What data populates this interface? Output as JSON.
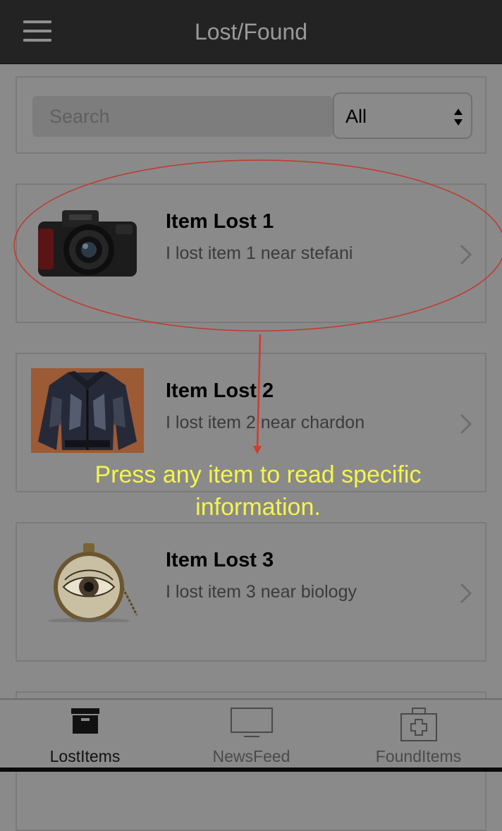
{
  "header": {
    "title": "Lost/Found",
    "menu_icon": "hamburger-icon"
  },
  "search": {
    "placeholder": "Search",
    "filter_value": "All"
  },
  "items": [
    {
      "title": "Item Lost 1",
      "description": "I lost item 1 near stefani",
      "image": "camera"
    },
    {
      "title": "Item Lost 2",
      "description": "I lost item 2 near chardon",
      "image": "jacket"
    },
    {
      "title": "Item Lost 3",
      "description": "I lost item 3 near biology",
      "image": "eye-pendant-necklace"
    }
  ],
  "tabs": [
    {
      "label": "LostItems",
      "icon": "archive-box-icon",
      "active": true
    },
    {
      "label": "NewsFeed",
      "icon": "monitor-icon",
      "active": false
    },
    {
      "label": "FoundItems",
      "icon": "first-aid-kit-icon",
      "active": false
    }
  ],
  "annotation": {
    "line1": "Press any item to read specific",
    "line2": "information.",
    "color": "#f5f54a",
    "ellipse_color": "#c0392b"
  }
}
